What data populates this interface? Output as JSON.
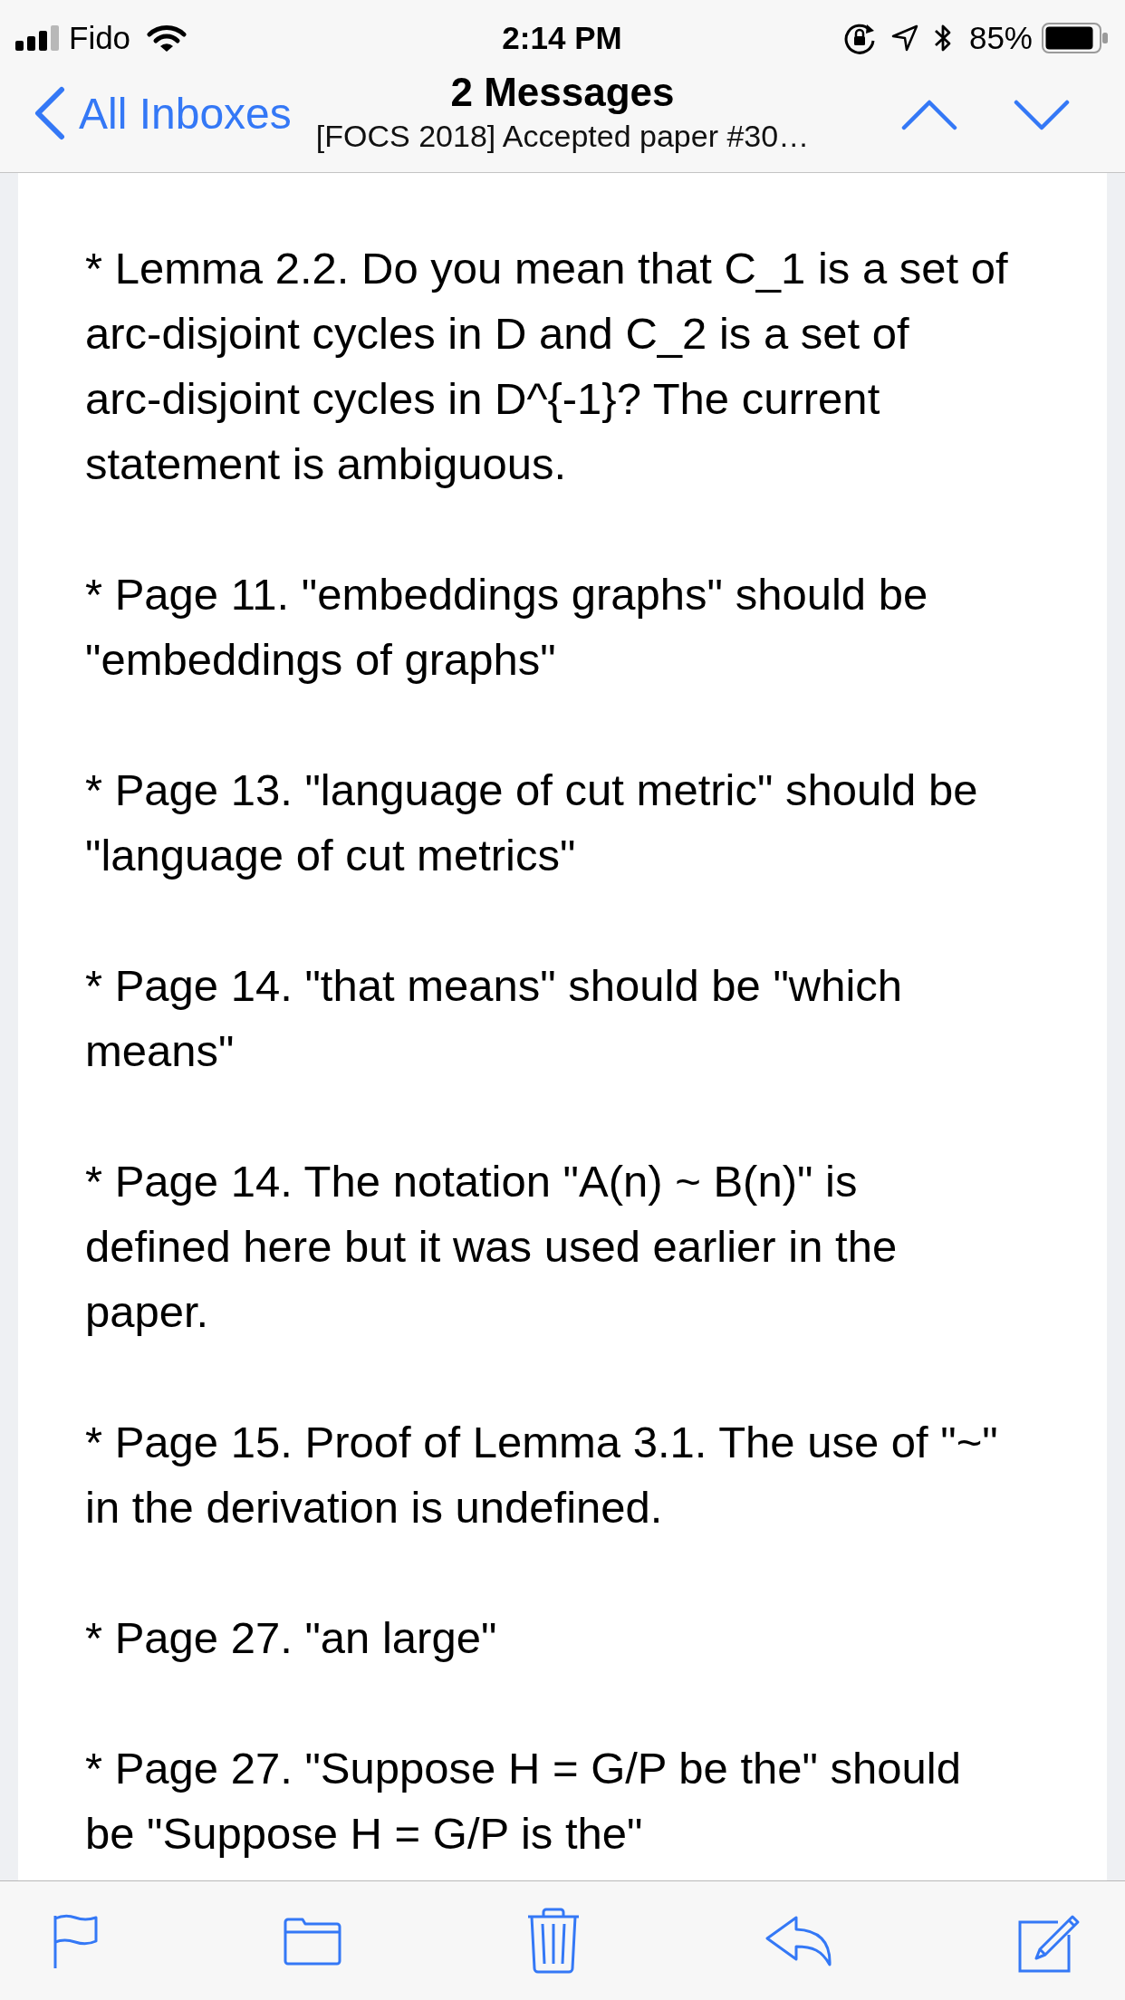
{
  "status_bar": {
    "carrier": "Fido",
    "time": "2:14 PM",
    "battery": "85%"
  },
  "nav_bar": {
    "back_label": "All Inboxes",
    "title": "2 Messages",
    "subtitle": "[FOCS 2018] Accepted paper #30…"
  },
  "message_body": {
    "paragraphs": [
      {
        "lines": [
          "* Lemma 2.2. Do you mean that C_1 is a set of",
          "arc-disjoint cycles in D and C_2 is a set of",
          "arc-disjoint cycles in D^{-1}? The current",
          "statement is ambiguous."
        ]
      },
      {
        "lines": [
          "* Page 11. \"embeddings graphs\" should be",
          "\"embeddings of graphs\""
        ]
      },
      {
        "lines": [
          "* Page 13. \"language of cut metric\" should be",
          "\"language of cut metrics\""
        ]
      },
      {
        "lines": [
          "* Page 14. \"that means\" should be \"which",
          "means\""
        ]
      },
      {
        "lines": [
          "* Page 14. The notation \"A(n) ~ B(n)\" is",
          "defined here but it was used earlier in the",
          "paper."
        ]
      },
      {
        "lines": [
          "* Page 15. Proof of Lemma 3.1. The use of \"~\"",
          "in the derivation is undefined."
        ]
      },
      {
        "lines": [
          "* Page 27. \"an large\""
        ]
      },
      {
        "lines": [
          "* Page 27. \"Suppose H = G/P be the\" should",
          "be \"Suppose H = G/P is the\""
        ]
      }
    ]
  }
}
